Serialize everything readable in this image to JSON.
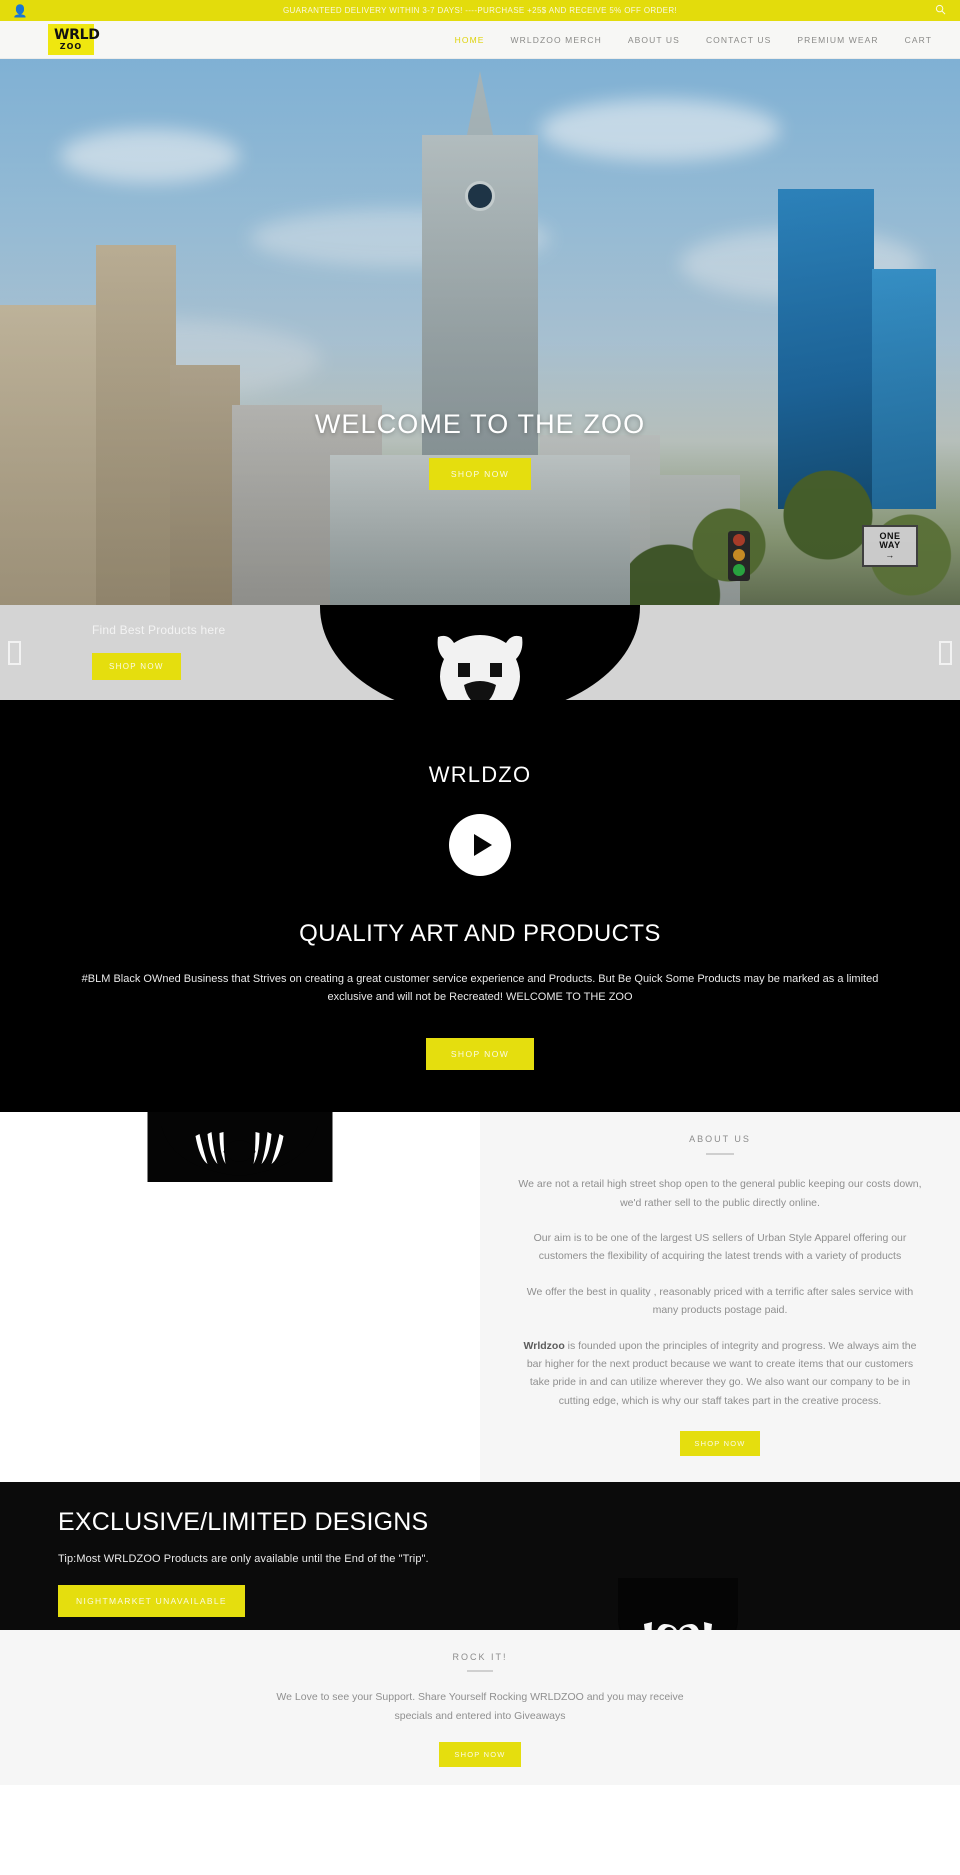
{
  "topbar": {
    "account_icon": "user-icon",
    "message": "GUARANTEED DELIVERY WITHIN 3-7 DAYS! ----PURCHASE +25$ AND RECEIVE 5% OFF ORDER!",
    "search_icon": "search-icon",
    "bg_color": "#e3dc0c"
  },
  "header": {
    "logo_top": "WRLD",
    "logo_bottom": "ZOO",
    "logo_bg": "#efe70f",
    "nav": [
      {
        "label": "HOME",
        "active": true
      },
      {
        "label": "WRLDZOO MERCH",
        "active": false
      },
      {
        "label": "ABOUT US",
        "active": false
      },
      {
        "label": "CONTACT US",
        "active": false
      },
      {
        "label": "PREMIUM WEAR",
        "active": false
      },
      {
        "label": "CART",
        "active": false
      }
    ],
    "active_color": "#ded30c"
  },
  "hero": {
    "title": "WELCOME TO THE ZOO",
    "cta": "SHOP NOW",
    "sign_line1": "ONE",
    "sign_line2": "WAY",
    "sign_arrow": "→",
    "traffic_red": "#c2452f",
    "traffic_amber": "#e8a32a",
    "traffic_green": "#2fbf4a"
  },
  "promo": {
    "title": "Find Best Products here",
    "cta": "SHOP NOW",
    "prev_icon": "chevron-left-icon",
    "next_icon": "chevron-right-icon",
    "bg_color": "#d4d4d4"
  },
  "video": {
    "heading": "WRLDZO",
    "play_icon": "play-icon",
    "subheading": "QUALITY ART AND PRODUCTS",
    "body": "#BLM Black OWned Business that Strives on creating a great customer service experience and Products. But Be Quick Some Products may be marked as a limited exclusive and will not be Recreated! WELCOME TO THE ZOO",
    "cta": "SHOP NOW"
  },
  "about": {
    "kicker": "ABOUT US",
    "p1": "We are not a retail high street shop open to the general public keeping our costs down, we'd rather sell to the public directly online.",
    "p2": "Our aim is to be one of the largest US sellers of Urban Style Apparel offering our customers the flexibility of acquiring the latest trends with a variety of products",
    "p3": "We offer the best in quality , reasonably priced with a terrific after sales service with many products postage paid.",
    "p4_brand": "Wrldzoo",
    "p4": " is founded upon the principles of integrity and progress. We always aim the bar higher for the next product because we want to create items that our customers take pride in and can utilize wherever they go. We also want our company to be in cutting edge, which is why our staff takes part in the creative process.",
    "cta": "SHOP NOW"
  },
  "exclusive": {
    "title": "EXCLUSIVE/LIMITED DESIGNS",
    "tip": "Tip:Most WRLDZOO Products are only available until the End of the \"Trip\".",
    "cta": "NIGHTMARKET UNAVAILABLE"
  },
  "rockit": {
    "kicker": "ROCK IT!",
    "body": "We Love to see your Support. Share Yourself Rocking WRLDZOO and you may receive specials and entered into Giveaways",
    "cta": "SHOP NOW"
  },
  "theme": {
    "yellow": "#e5de0e",
    "black": "#000000",
    "gray_bg": "#f6f6f6"
  }
}
